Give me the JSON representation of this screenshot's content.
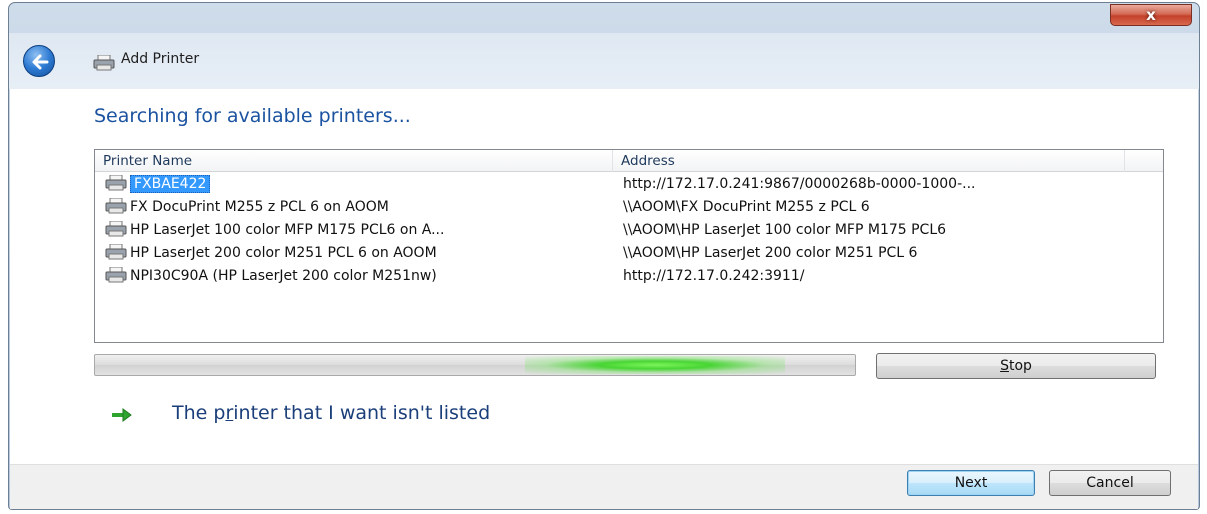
{
  "window": {
    "title": "Add Printer",
    "close_label": "x"
  },
  "main": {
    "heading": "Searching for available printers...",
    "columns": {
      "name": "Printer Name",
      "address": "Address"
    },
    "printers": [
      {
        "name": "FXBAE422",
        "address": "http://172.17.0.241:9867/0000268b-0000-1000-...",
        "selected": true
      },
      {
        "name": "FX DocuPrint M255 z PCL 6 on AOOM",
        "address": "\\\\AOOM\\FX DocuPrint M255 z PCL 6",
        "selected": false
      },
      {
        "name": "HP LaserJet 100 color MFP M175 PCL6 on A...",
        "address": "\\\\AOOM\\HP LaserJet 100 color MFP M175 PCL6",
        "selected": false
      },
      {
        "name": "HP LaserJet 200 color M251 PCL 6 on AOOM",
        "address": "\\\\AOOM\\HP LaserJet 200 color M251 PCL 6",
        "selected": false
      },
      {
        "name": "NPI30C90A (HP LaserJet 200 color M251nw)",
        "address": "http://172.17.0.242:3911/",
        "selected": false
      }
    ],
    "stop_button": {
      "accel": "S",
      "rest": "top"
    },
    "not_listed": {
      "before": "The p",
      "accel": "r",
      "after": "inter that I want isn't listed"
    }
  },
  "footer": {
    "next_label": "Next",
    "cancel_label": "Cancel"
  },
  "colors": {
    "heading": "#1b53a0",
    "selection": "#3399ff",
    "progress_glow": "#48d534"
  },
  "icons": {
    "back": "back-arrow-icon",
    "printer": "printer-icon",
    "link_arrow": "green-arrow-icon",
    "close": "close-icon"
  }
}
